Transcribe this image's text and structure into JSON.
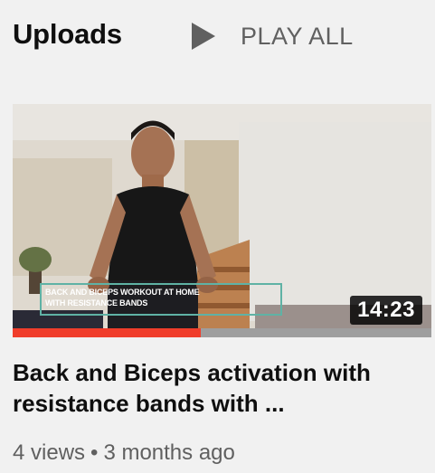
{
  "section": {
    "title": "Uploads",
    "play_all_label": "PLAY ALL",
    "play_icon": "play-icon"
  },
  "video": {
    "duration": "14:23",
    "overlay_line1": "BACK AND BICEPS WORKOUT AT HOME",
    "overlay_line2": "WITH RESISTANCE BANDS",
    "watch_progress": 0.45,
    "title": "Back and Biceps activation with resistance bands with ...",
    "views": "4 views",
    "separator": "•",
    "age": "3 months ago"
  },
  "colors": {
    "background": "#f1f1f1",
    "progress": "#f03d2b",
    "meta_text": "#606060"
  }
}
